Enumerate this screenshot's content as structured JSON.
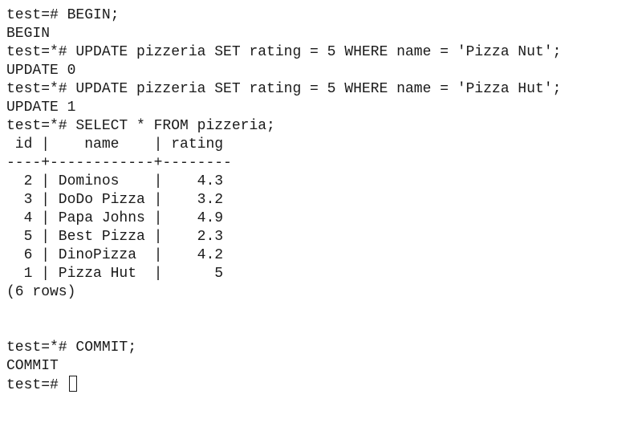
{
  "terminal": {
    "lines": [
      "test=# BEGIN;",
      "BEGIN",
      "test=*# UPDATE pizzeria SET rating = 5 WHERE name = 'Pizza Nut';",
      "UPDATE 0",
      "test=*# UPDATE pizzeria SET rating = 5 WHERE name = 'Pizza Hut';",
      "UPDATE 1",
      "test=*# SELECT * FROM pizzeria;",
      " id |    name    | rating",
      "----+------------+--------",
      "  2 | Dominos    |    4.3",
      "  3 | DoDo Pizza |    3.2",
      "  4 | Papa Johns |    4.9",
      "  5 | Best Pizza |    2.3",
      "  6 | DinoPizza  |    4.2",
      "  1 | Pizza Hut  |      5",
      "(6 rows)",
      "",
      "",
      "test=*# COMMIT;",
      "COMMIT",
      "test=# "
    ]
  }
}
